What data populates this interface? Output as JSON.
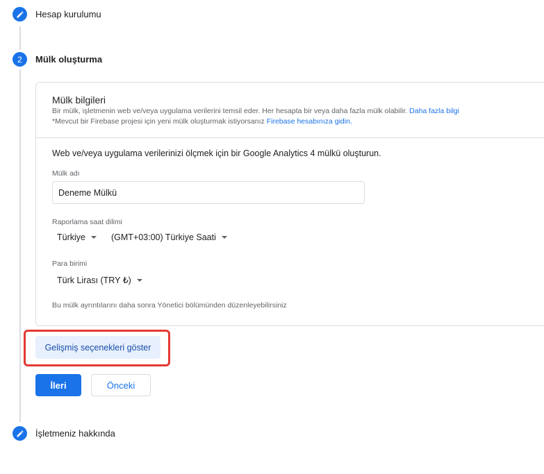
{
  "steps": [
    {
      "label": "Hesap kurulumu",
      "state": "done",
      "icon": "pencil-icon"
    },
    {
      "label": "Mülk oluşturma",
      "state": "active",
      "number": "2"
    },
    {
      "label": "İşletmeniz hakkında",
      "state": "done",
      "icon": "pencil-icon"
    }
  ],
  "card": {
    "title": "Mülk bilgileri",
    "desc1_text": "Bir mülk, işletmenin web ve/veya uygulama verilerini temsil eder. Her hesapta bir veya daha fazla mülk olabilir.",
    "desc1_link": "Daha fazla bilgi",
    "desc2_text": "*Mevcut bir Firebase projesi için yeni mülk oluşturmak istiyorsanız",
    "desc2_link": "Firebase hesabınıza gidin.",
    "intro": "Web ve/veya uygulama verilerinizi ölçmek için bir Google Analytics 4 mülkü oluşturun.",
    "property_name_label": "Mülk adı",
    "property_name_value": "Deneme Mülkü",
    "timezone_label": "Raporlama saat dilimi",
    "country_value": "Türkiye",
    "timezone_value": "(GMT+03:00) Türkiye Saati",
    "currency_label": "Para birimi",
    "currency_value": "Türk Lirası (TRY ₺)",
    "note": "Bu mülk ayrıntılarını daha sonra Yönetici bölümünden düzenleyebilirsiniz"
  },
  "buttons": {
    "advanced": "Gelişmiş seçenekleri göster",
    "next": "İleri",
    "previous": "Önceki"
  },
  "colors": {
    "accent": "#1a73e8",
    "highlight": "#e53935"
  }
}
